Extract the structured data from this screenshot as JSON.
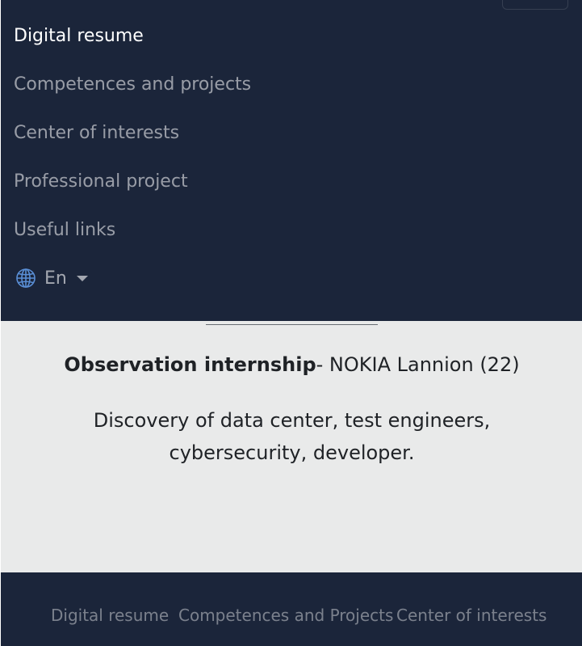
{
  "nav": {
    "items": [
      {
        "label": "Digital resume"
      },
      {
        "label": "Competences and projects"
      },
      {
        "label": "Center of interests"
      },
      {
        "label": "Professional project"
      },
      {
        "label": "Useful links"
      }
    ],
    "language": {
      "icon": "globe-icon",
      "label": "En"
    }
  },
  "entry": {
    "title_bold": "Observation internship",
    "title_rest": "- NOKIA Lannion (22)",
    "description": "Discovery of data center, test engineers, cybersecurity, developer."
  },
  "footer": {
    "links": [
      {
        "label": "Digital resume"
      },
      {
        "label": "Competences and Projects"
      },
      {
        "label": "Center of interests"
      }
    ]
  },
  "colors": {
    "navbar_bg": "#1b253a",
    "content_bg": "#e9eaea",
    "text_dark": "#1f2226"
  }
}
